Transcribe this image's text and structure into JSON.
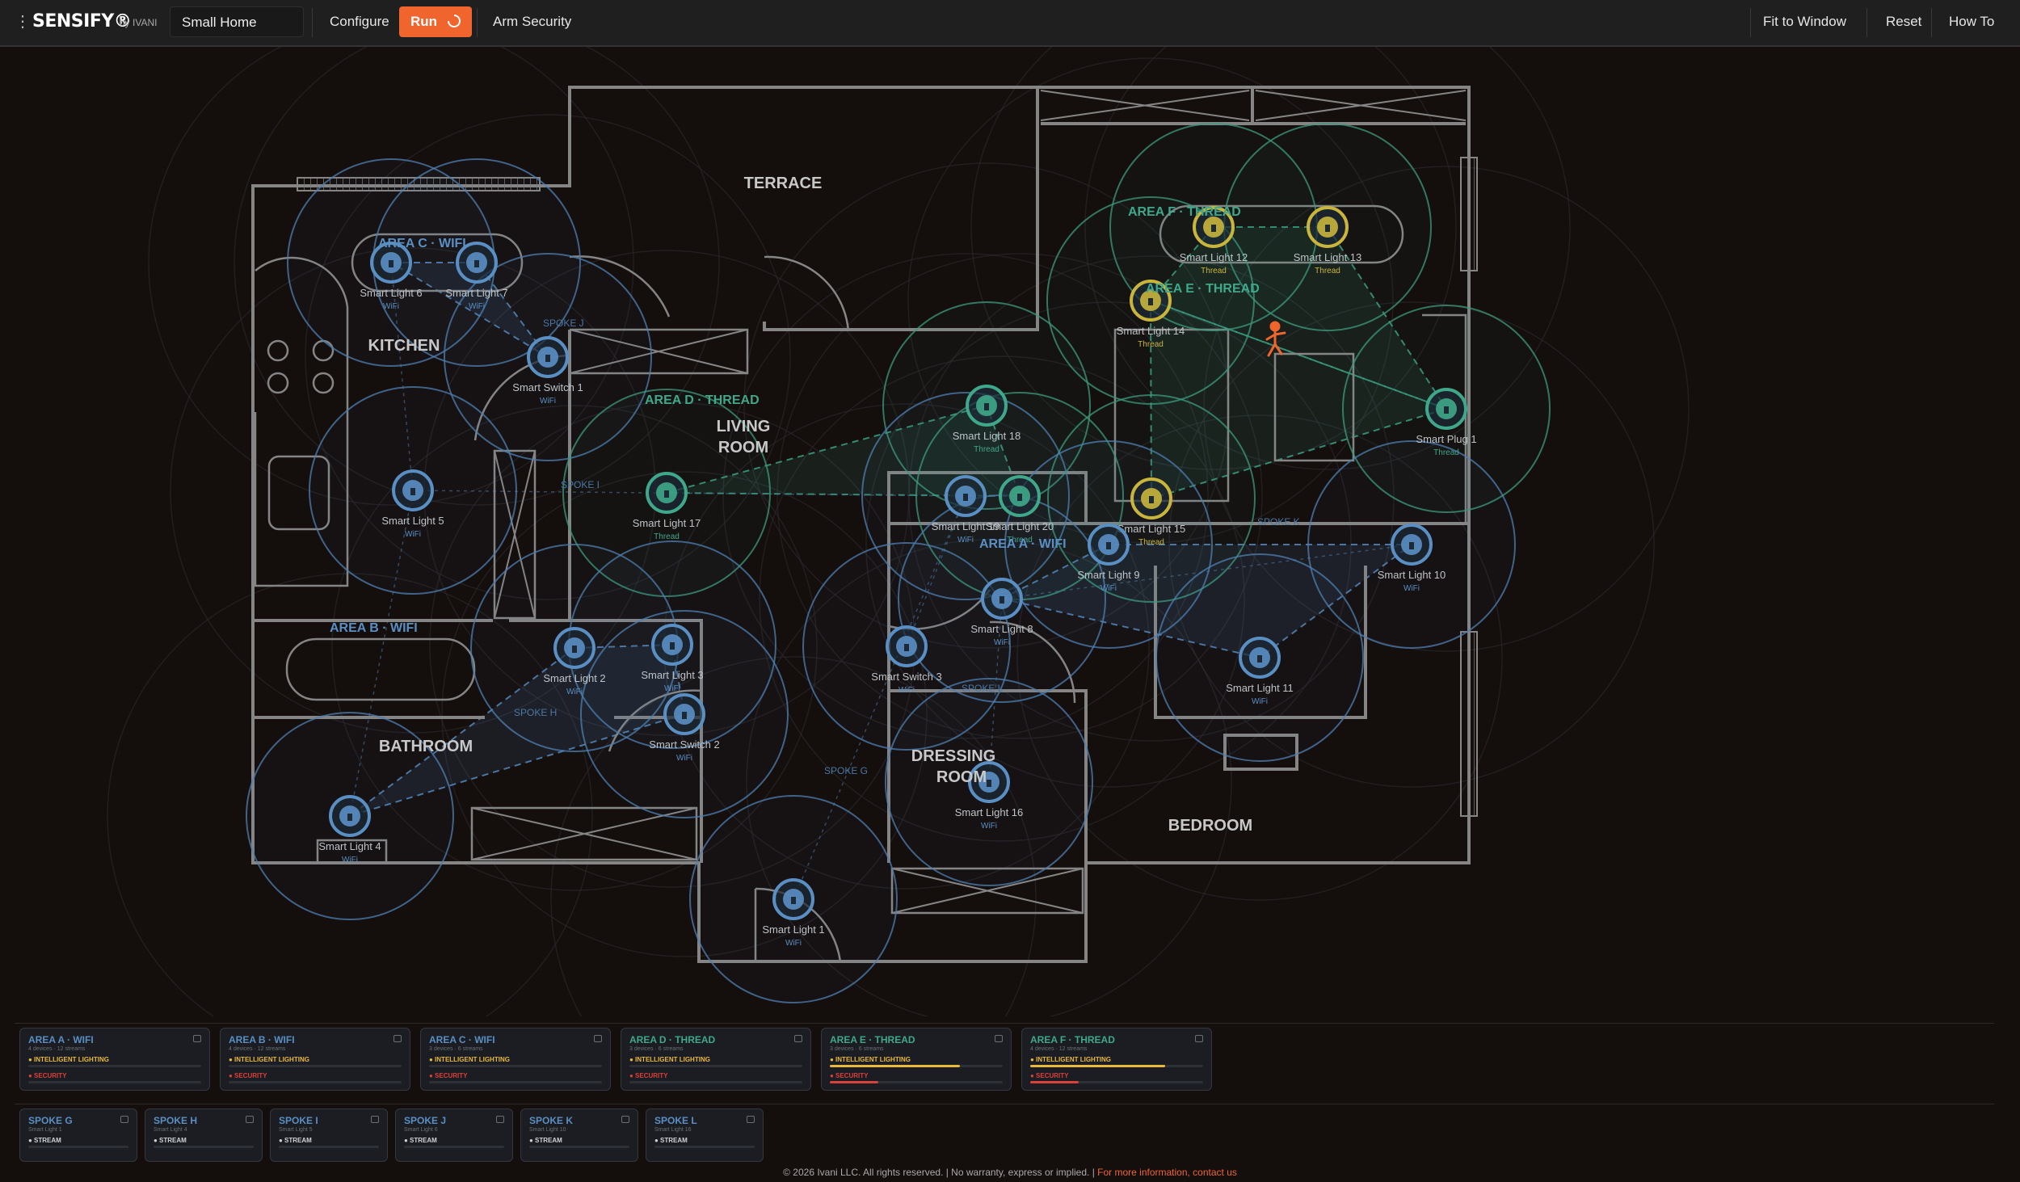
{
  "app": {
    "logo": "SENSIFY®",
    "byline": "by IVANI",
    "project": "Small Home"
  },
  "toolbar": {
    "configure": "Configure",
    "run": "Run",
    "arm": "Arm Security",
    "fit": "Fit to Window",
    "reset": "Reset",
    "howto": "How To"
  },
  "colors": {
    "accent": "#f0652e",
    "wifi": "#5a8fc4",
    "thread": "#3fa88a",
    "thread_light": "#c9b53c",
    "intelligent": "#e8b93a",
    "security": "#d9413b"
  },
  "rooms": {
    "terrace": "TERRACE",
    "kitchen": "KITCHEN",
    "living1": "LIVING",
    "living2": "ROOM",
    "bathroom": "BATHROOM",
    "dressing1": "DRESSING",
    "dressing2": "ROOM",
    "bedroom": "BEDROOM"
  },
  "map_areas": {
    "a": "AREA A · WIFI",
    "b": "AREA B · WIFI",
    "c": "AREA C · WIFI",
    "d": "AREA D · THREAD",
    "e": "AREA E · THREAD",
    "f": "AREA F · THREAD"
  },
  "spokes": {
    "g": "SPOKE G",
    "h": "SPOKE H",
    "i": "SPOKE I",
    "j": "SPOKE J",
    "k": "SPOKE K",
    "l": "SPOKE L"
  },
  "devices": [
    {
      "name": "Smart Light 6",
      "proto": "WiFi"
    },
    {
      "name": "Smart Light 7",
      "proto": "WiFi"
    },
    {
      "name": "Smart Switch 1",
      "proto": "WiFi"
    },
    {
      "name": "Smart Light 5",
      "proto": "WiFi"
    },
    {
      "name": "Smart Light 17",
      "proto": "Thread"
    },
    {
      "name": "Smart Light 18",
      "proto": "Thread"
    },
    {
      "name": "Smart Light 19",
      "proto": "WiFi"
    },
    {
      "name": "Smart Light 20",
      "proto": "Thread"
    },
    {
      "name": "Smart Light 12",
      "proto": "Thread"
    },
    {
      "name": "Smart Light 13",
      "proto": "Thread"
    },
    {
      "name": "Smart Light 14",
      "proto": "Thread"
    },
    {
      "name": "Smart Plug 1",
      "proto": "Thread"
    },
    {
      "name": "Smart Light 15",
      "proto": "Thread"
    },
    {
      "name": "Smart Light 9",
      "proto": "WiFi"
    },
    {
      "name": "Smart Light 10",
      "proto": "WiFi"
    },
    {
      "name": "Smart Light 8",
      "proto": "WiFi"
    },
    {
      "name": "Smart Switch 3",
      "proto": "WiFi"
    },
    {
      "name": "Smart Light 11",
      "proto": "WiFi"
    },
    {
      "name": "Smart Light 2",
      "proto": "WiFi"
    },
    {
      "name": "Smart Light 3",
      "proto": "WiFi"
    },
    {
      "name": "Smart Switch 2",
      "proto": "WiFi"
    },
    {
      "name": "Smart Light 4",
      "proto": "WiFi"
    },
    {
      "name": "Smart Light 16",
      "proto": "WiFi"
    },
    {
      "name": "Smart Light 1",
      "proto": "WiFi"
    }
  ],
  "area_cards": [
    {
      "title": "AREA A · WIFI",
      "sub": "4 devices · 12 streams",
      "r1": "● INTELLIGENT LIGHTING",
      "r2": "● SECURITY",
      "lvl1": 0,
      "lvl2": 0
    },
    {
      "title": "AREA B · WIFI",
      "sub": "4 devices · 12 streams",
      "r1": "● INTELLIGENT LIGHTING",
      "r2": "● SECURITY",
      "lvl1": 0,
      "lvl2": 0
    },
    {
      "title": "AREA C · WIFI",
      "sub": "3 devices · 6 streams",
      "r1": "● INTELLIGENT LIGHTING",
      "r2": "● SECURITY",
      "lvl1": 0,
      "lvl2": 0
    },
    {
      "title": "AREA D · THREAD",
      "sub": "3 devices · 6 streams",
      "r1": "● INTELLIGENT LIGHTING",
      "r2": "● SECURITY",
      "lvl1": 0,
      "lvl2": 0
    },
    {
      "title": "AREA E · THREAD",
      "sub": "3 devices · 6 streams",
      "r1": "● INTELLIGENT LIGHTING",
      "r2": "● SECURITY",
      "lvl1": 0.75,
      "lvl2": 0.28
    },
    {
      "title": "AREA F · THREAD",
      "sub": "4 devices · 12 streams",
      "r1": "● INTELLIGENT LIGHTING",
      "r2": "● SECURITY",
      "lvl1": 0.78,
      "lvl2": 0.28
    }
  ],
  "spoke_cards": [
    {
      "title": "SPOKE G",
      "sub": "Smart Light 1",
      "r1": "● STREAM"
    },
    {
      "title": "SPOKE H",
      "sub": "Smart Light 4",
      "r1": "● STREAM"
    },
    {
      "title": "SPOKE I",
      "sub": "Smart Light 5",
      "r1": "● STREAM"
    },
    {
      "title": "SPOKE J",
      "sub": "Smart Light 6",
      "r1": "● STREAM"
    },
    {
      "title": "SPOKE K",
      "sub": "Smart Light 10",
      "r1": "● STREAM"
    },
    {
      "title": "SPOKE L",
      "sub": "Smart Light 16",
      "r1": "● STREAM"
    }
  ],
  "footer": {
    "text": "© 2026 Ivani LLC. All rights reserved. | No warranty, express or implied. | ",
    "link": "For more information, contact us"
  }
}
